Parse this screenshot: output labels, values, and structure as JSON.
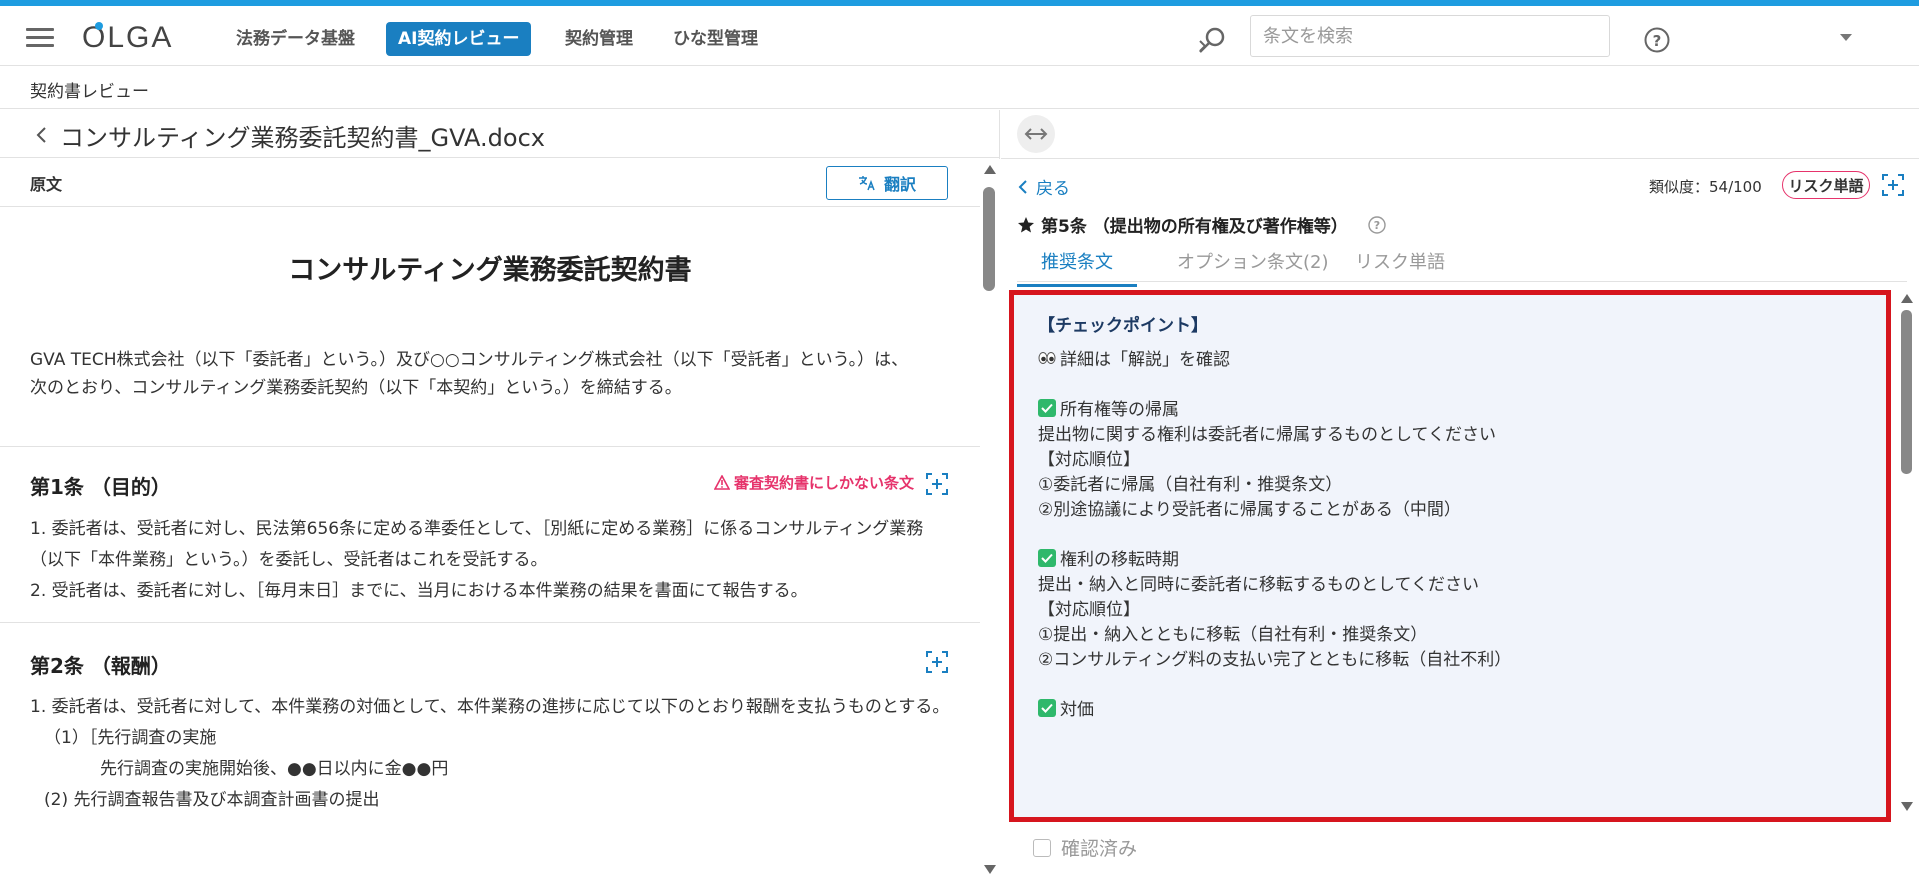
{
  "app": {
    "logo_text": "OLGA",
    "accent_color": "#1e9ce0",
    "nav": [
      {
        "label": "法務データ基盤",
        "active": false
      },
      {
        "label": "AI契約レビュー",
        "active": true
      },
      {
        "label": "契約管理",
        "active": false
      },
      {
        "label": "ひな型管理",
        "active": false
      }
    ],
    "search_placeholder": "条文を検索"
  },
  "breadcrumb": {
    "label": "契約書レビュー"
  },
  "left": {
    "doc_title": "コンサルティング業務委託契約書_GVA.docx",
    "original_label": "原文",
    "translate_label": "翻訳",
    "heading": "コンサルティング業務委託契約書",
    "preamble": "GVA TECH株式会社（以下「委託者」という。）及び○○コンサルティング株式会社（以下「受託者」という。）は、次のとおり、コンサルティング業務委託契約（以下「本契約」という。）を締結する。",
    "articles": [
      {
        "title": "第1条 （目的）",
        "badge": "審査契約書にしかない条文",
        "lines": [
          "1. 委託者は、受託者に対し、民法第656条に定める準委任として、［別紙に定める業務］に係るコンサルティング業務（以下「本件業務」という。）を委託し、受託者はこれを受託する。",
          "2. 受託者は、委託者に対し、［毎月末日］までに、当月における本件業務の結果を書面にて報告する。"
        ]
      },
      {
        "title": "第2条 （報酬）",
        "lines": [
          "1. 委託者は、受託者に対して、本件業務の対価として、本件業務の進捗に応じて以下のとおり報酬を支払うものとする。",
          "（1）［先行調査の実施",
          "先行調査の実施開始後、●●日以内に金●●円",
          "(2) 先行調査報告書及び本調査計画書の提出"
        ]
      }
    ]
  },
  "right": {
    "back_label": "戻る",
    "similarity": "類似度：54/100",
    "risk_pill": "リスク単語",
    "clause_title": "第5条 （提出物の所有権及び著作権等）",
    "tabs": [
      "推奨条文",
      "オプション条文(2)",
      "リスク単語"
    ],
    "checkpoint": {
      "heading": "【チェックポイント】",
      "detail": "詳細は「解説」を確認",
      "sections": [
        {
          "title": "所有権等の帰属",
          "lines": [
            "提出物に関する権利は委託者に帰属するものとしてください",
            "【対応順位】",
            "①委託者に帰属（自社有利・推奨条文）",
            "②別途協議により受託者に帰属することがある（中間）"
          ]
        },
        {
          "title": "権利の移転時期",
          "lines": [
            "提出・納入と同時に委託者に移転するものとしてください",
            "【対応順位】",
            "①提出・納入とともに移転（自社有利・推奨条文）",
            "②コンサルティング料の支払い完了とともに移転（自社不利）"
          ]
        },
        {
          "title": "対価",
          "lines": []
        }
      ]
    },
    "confirm_label": "確認済み"
  }
}
